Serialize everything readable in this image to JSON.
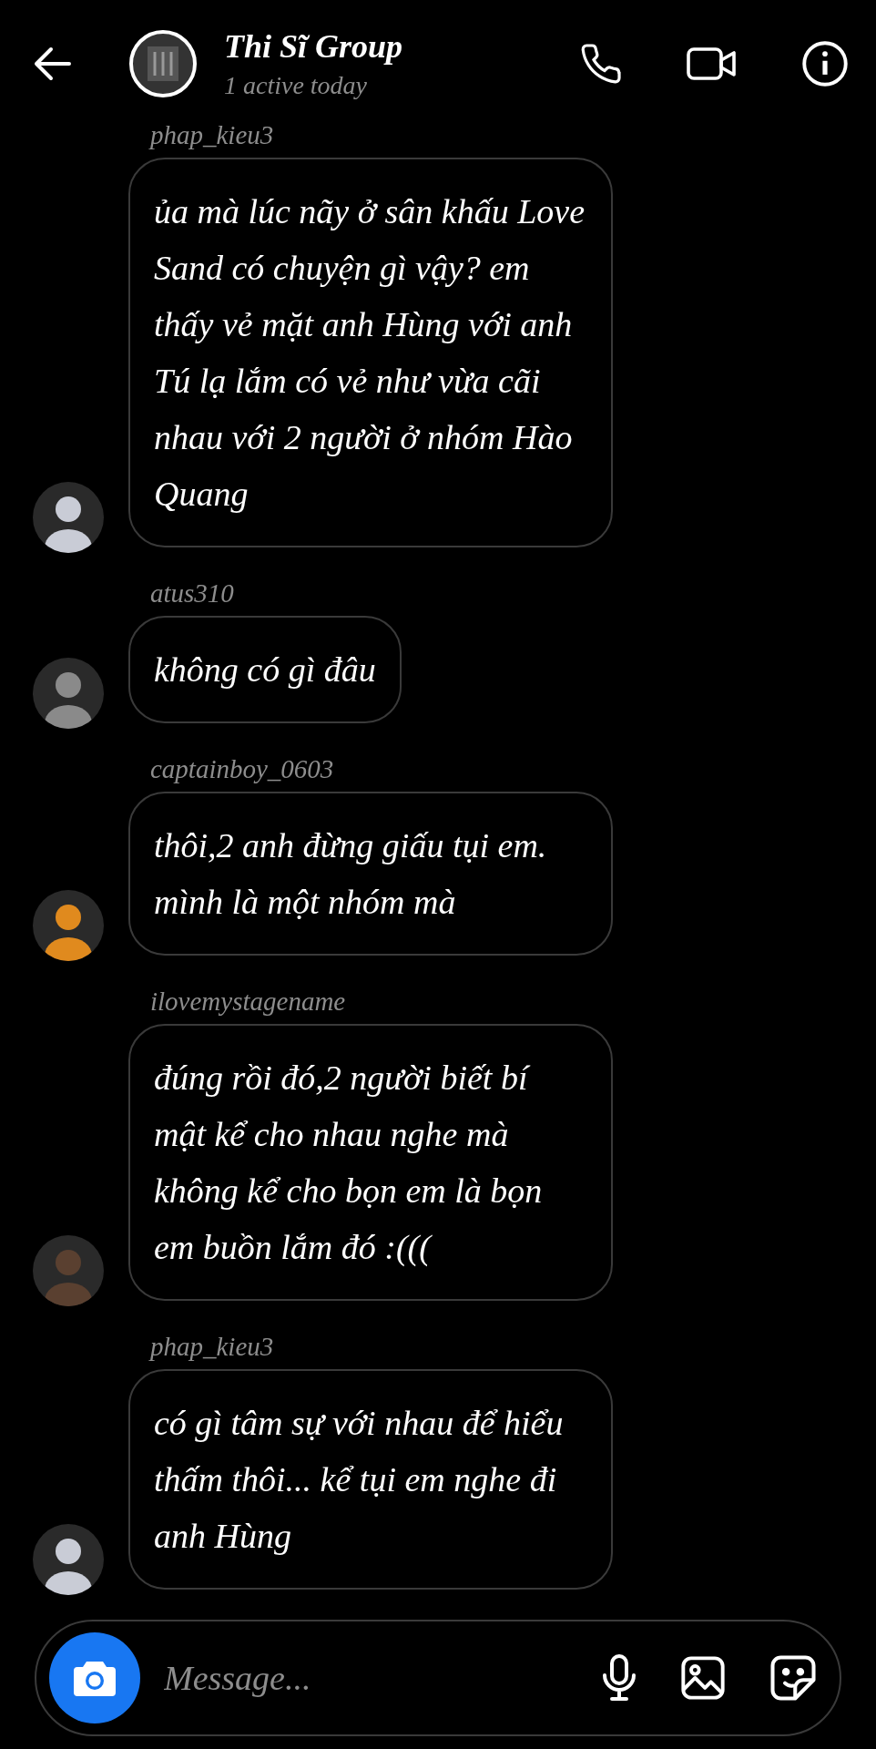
{
  "header": {
    "title": "Thi Sĩ Group",
    "subtitle": "1 active today"
  },
  "messages": [
    {
      "sender": "phap_kieu3",
      "text": "ủa mà lúc nãy ở sân khấu Love Sand có chuyện gì vậy? em thấy vẻ mặt anh Hùng với anh Tú lạ lắm có vẻ như vừa cãi nhau với 2 người ở nhóm Hào Quang"
    },
    {
      "sender": "atus310",
      "text": "không có gì đâu"
    },
    {
      "sender": "captainboy_0603",
      "text": "thôi,2 anh đừng giấu tụi em. mình là một nhóm mà"
    },
    {
      "sender": "ilovemystagename",
      "text": "đúng rồi đó,2 người biết bí mật kể cho nhau nghe mà không kể cho bọn em là bọn em buồn lắm đó :((("
    },
    {
      "sender": "phap_kieu3",
      "text": "có gì tâm sự với nhau để hiểu thấm thôi... kể tụi em nghe đi anh Hùng"
    }
  ],
  "composer": {
    "placeholder": "Message..."
  }
}
